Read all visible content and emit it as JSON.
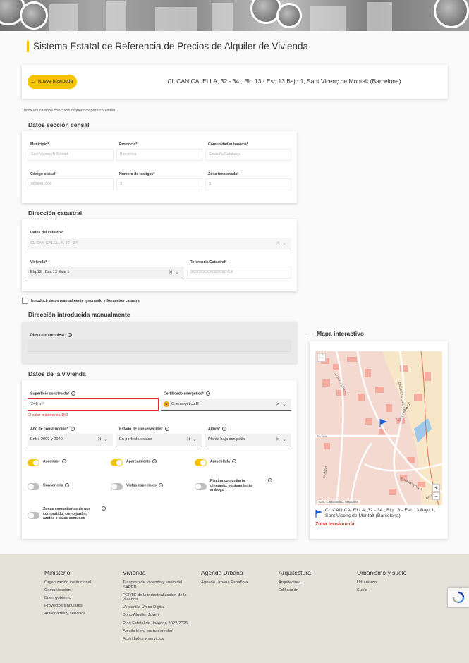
{
  "page": {
    "title": "Sistema Estatal de Referencia de Precios de Alquiler de Vivienda"
  },
  "search": {
    "new_search_label": "Nueva búsqueda",
    "address": "CL CAN CALELLA, 32 - 34 , Blq.13 - Esc.13 Bajo 1, Sant Vicenç de Montalt (Barcelona)"
  },
  "required_note": "Todos los campos con * son requeridos para continuar",
  "census": {
    "title": "Datos sección censal",
    "municipio_label": "Municipio*",
    "municipio_value": "Sant Vicenç de Montalt",
    "provincia_label": "Provincia*",
    "provincia_value": "Barcelona",
    "comunidad_label": "Comunidad autónoma*",
    "comunidad_value": "Cataluña/Catalunya",
    "codigo_label": "Código censal*",
    "codigo_value": "0826401004",
    "testigos_label": "Número de testigos*",
    "testigos_value": "31",
    "zona_label": "Zona tensionada*",
    "zona_value": "Sí"
  },
  "cadastral": {
    "title": "Dirección catastral",
    "datos_label": "Datos del catastro*",
    "datos_value": "CL CAN CALELLA, 32 - 34",
    "vivienda_label": "Vivienda*",
    "vivienda_value": "Blq.13 - Esc.13 Bajo 1",
    "referencia_label": "Referencia Catastral*",
    "referencia_value": "9522203DG5092S0014LK"
  },
  "manual_checkbox_label": "Introducir datos manualmente ignorando información catastral",
  "manual": {
    "title": "Dirección introducida manualmente",
    "completa_label": "Dirección completa*"
  },
  "housing": {
    "title": "Datos de la vivienda",
    "superficie_label": "Superficie construida*",
    "superficie_value": "248  m²",
    "superficie_error": "El valor máximo es 150",
    "certificado_label": "Certificado energético*",
    "certificado_badge": "E",
    "certificado_value": "C. energético E",
    "anio_label": "Año de construcción*",
    "anio_value": "Entre 2009 y 2020",
    "estado_label": "Estado de conservación*",
    "estado_value": "En perfecto estado",
    "altura_label": "Altura*",
    "altura_value": "Planta baja con patio",
    "toggles": [
      {
        "label": "Ascensor",
        "on": true
      },
      {
        "label": "Aparcamiento",
        "on": true
      },
      {
        "label": "Amueblada",
        "on": true
      },
      {
        "label": "Conserjería",
        "on": false
      },
      {
        "label": "Vistas especiales",
        "on": false
      },
      {
        "label": "Piscina comunitaria, gimnasio, equipamiento análogo",
        "on": false
      },
      {
        "label": "Zonas comunitarias de uso compartido, como jardín, azotea o salas comunes",
        "on": false
      }
    ],
    "help_glyph": "?"
  },
  "map": {
    "title": "Mapa interactivo",
    "street_labels": [
      "CL CAN CALELLA",
      "CALLE CAN CALELLA",
      "CALLE FRANCIS",
      "Riu Bell",
      "PASSEIG",
      "CALLE MONTSANT",
      "CALLE"
    ],
    "attribution": "IGN, Cartociudad, MapLibre",
    "zoom_in": "+",
    "zoom_out": "−",
    "address": "CL CAN CALELLA, 32 - 34 , Blq.13 - Esc.13 Bajo 1, Sant Vicenç de Montalt (Barcelona)",
    "zone": "Zona tensionada"
  },
  "footer": {
    "columns": [
      {
        "title": "Ministerio",
        "links": [
          "Organización institucional",
          "Comunicación",
          "Buen gobierno",
          "Proyectos singulares",
          "Actividades y servicios"
        ]
      },
      {
        "title": "Vivienda",
        "links": [
          "Traspaso de vivienda y suelo del SAREB",
          "PERTE de la industrialización de la vivienda",
          "Ventanilla Única Digital",
          "Bono Alquiler Joven",
          "Plan Estatal de Vivienda 2022-2025",
          "Alquila bien, ¡es tu derecho!",
          "Actividades y servicios"
        ]
      },
      {
        "title": "Agenda Urbana",
        "links": [
          "Agenda Urbana Española"
        ]
      },
      {
        "title": "Arquitectura",
        "links": [
          "Arquitectura",
          "Edificación"
        ]
      },
      {
        "title": "Urbanismo y suelo",
        "links": [
          "Urbanismo",
          "Suelo"
        ]
      }
    ]
  },
  "colors": {
    "accent": "#f5c400",
    "error": "#d9302f",
    "zone": "#c0392b",
    "marker": "#1a5fd6"
  }
}
